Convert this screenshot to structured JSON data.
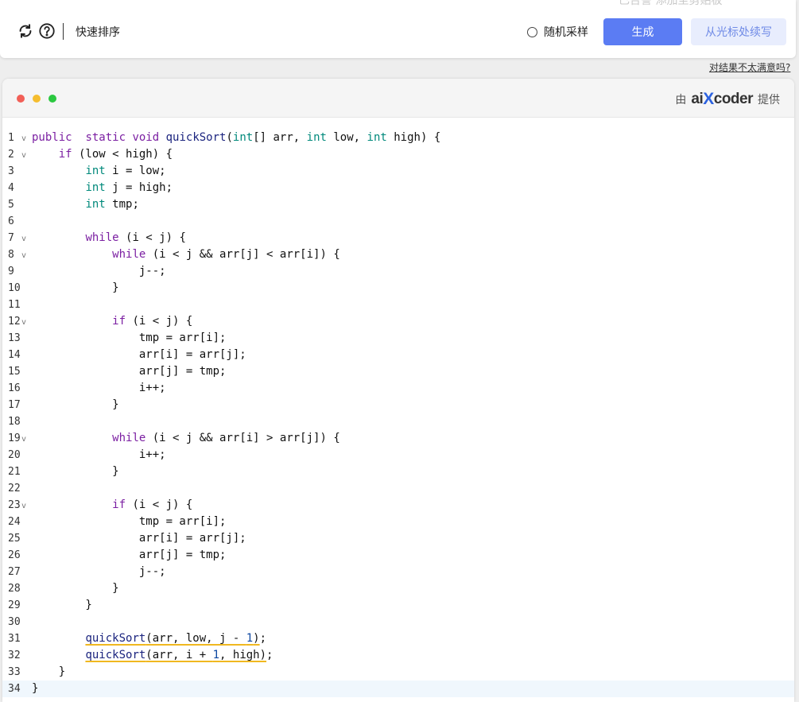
{
  "topbar": {
    "ghost_text": "已告警  添加至剪贴板",
    "mode_label": "快速排序",
    "random_sampling_label": "随机采样",
    "generate_label": "生成",
    "continue_label": "从光标处续写"
  },
  "feedback_link": "对结果不太满意吗?",
  "editor": {
    "provider_prefix": "由",
    "brand_left": "ai",
    "brand_x": "X",
    "brand_right": "coder",
    "provider_suffix": "提供",
    "active_line": 34,
    "lines": [
      {
        "n": "1",
        "fold": true,
        "tokens": [
          [
            "kw",
            "public"
          ],
          [
            "",
            "  "
          ],
          [
            "kw",
            "static"
          ],
          [
            "",
            " "
          ],
          [
            "kw",
            "void"
          ],
          [
            "",
            " "
          ],
          [
            "fn",
            "quickSort"
          ],
          [
            "",
            "("
          ],
          [
            "ty",
            "int"
          ],
          [
            "",
            "[] arr, "
          ],
          [
            "ty",
            "int"
          ],
          [
            "",
            " low, "
          ],
          [
            "ty",
            "int"
          ],
          [
            "",
            " high) {"
          ]
        ]
      },
      {
        "n": "2",
        "fold": true,
        "tokens": [
          [
            "",
            "    "
          ],
          [
            "kw",
            "if"
          ],
          [
            "",
            " (low < high) {"
          ]
        ]
      },
      {
        "n": "3",
        "fold": false,
        "tokens": [
          [
            "",
            "        "
          ],
          [
            "ty",
            "int"
          ],
          [
            "",
            " i = low;"
          ]
        ]
      },
      {
        "n": "4",
        "fold": false,
        "tokens": [
          [
            "",
            "        "
          ],
          [
            "ty",
            "int"
          ],
          [
            "",
            " j = high;"
          ]
        ]
      },
      {
        "n": "5",
        "fold": false,
        "tokens": [
          [
            "",
            "        "
          ],
          [
            "ty",
            "int"
          ],
          [
            "",
            " tmp;"
          ]
        ]
      },
      {
        "n": "6",
        "fold": false,
        "tokens": []
      },
      {
        "n": "7",
        "fold": true,
        "tokens": [
          [
            "",
            "        "
          ],
          [
            "kw",
            "while"
          ],
          [
            "",
            " (i < j) {"
          ]
        ]
      },
      {
        "n": "8",
        "fold": true,
        "tokens": [
          [
            "",
            "            "
          ],
          [
            "kw",
            "while"
          ],
          [
            "",
            " (i < j && arr[j] < arr[i]) {"
          ]
        ]
      },
      {
        "n": "9",
        "fold": false,
        "tokens": [
          [
            "",
            "                j--;"
          ]
        ]
      },
      {
        "n": "10",
        "fold": false,
        "tokens": [
          [
            "",
            "            }"
          ]
        ]
      },
      {
        "n": "11",
        "fold": false,
        "tokens": []
      },
      {
        "n": "12",
        "fold": true,
        "tokens": [
          [
            "",
            "            "
          ],
          [
            "kw",
            "if"
          ],
          [
            "",
            " (i < j) {"
          ]
        ]
      },
      {
        "n": "13",
        "fold": false,
        "tokens": [
          [
            "",
            "                tmp = arr[i];"
          ]
        ]
      },
      {
        "n": "14",
        "fold": false,
        "tokens": [
          [
            "",
            "                arr[i] = arr[j];"
          ]
        ]
      },
      {
        "n": "15",
        "fold": false,
        "tokens": [
          [
            "",
            "                arr[j] = tmp;"
          ]
        ]
      },
      {
        "n": "16",
        "fold": false,
        "tokens": [
          [
            "",
            "                i++;"
          ]
        ]
      },
      {
        "n": "17",
        "fold": false,
        "tokens": [
          [
            "",
            "            }"
          ]
        ]
      },
      {
        "n": "18",
        "fold": false,
        "tokens": []
      },
      {
        "n": "19",
        "fold": true,
        "tokens": [
          [
            "",
            "            "
          ],
          [
            "kw",
            "while"
          ],
          [
            "",
            " (i < j && arr[i] > arr[j]) {"
          ]
        ]
      },
      {
        "n": "20",
        "fold": false,
        "tokens": [
          [
            "",
            "                i++;"
          ]
        ]
      },
      {
        "n": "21",
        "fold": false,
        "tokens": [
          [
            "",
            "            }"
          ]
        ]
      },
      {
        "n": "22",
        "fold": false,
        "tokens": []
      },
      {
        "n": "23",
        "fold": true,
        "tokens": [
          [
            "",
            "            "
          ],
          [
            "kw",
            "if"
          ],
          [
            "",
            " (i < j) {"
          ]
        ]
      },
      {
        "n": "24",
        "fold": false,
        "tokens": [
          [
            "",
            "                tmp = arr[i];"
          ]
        ]
      },
      {
        "n": "25",
        "fold": false,
        "tokens": [
          [
            "",
            "                arr[i] = arr[j];"
          ]
        ]
      },
      {
        "n": "26",
        "fold": false,
        "tokens": [
          [
            "",
            "                arr[j] = tmp;"
          ]
        ]
      },
      {
        "n": "27",
        "fold": false,
        "tokens": [
          [
            "",
            "                j--;"
          ]
        ]
      },
      {
        "n": "28",
        "fold": false,
        "tokens": [
          [
            "",
            "            }"
          ]
        ]
      },
      {
        "n": "29",
        "fold": false,
        "tokens": [
          [
            "",
            "        }"
          ]
        ]
      },
      {
        "n": "30",
        "fold": false,
        "tokens": []
      },
      {
        "n": "31",
        "fold": false,
        "tokens": [
          [
            "",
            "        "
          ],
          [
            "fn squiggle",
            "quickSort"
          ],
          [
            "squiggle",
            "(arr, low, j - "
          ],
          [
            "num squiggle",
            "1"
          ],
          [
            "squiggle",
            ")"
          ],
          [
            "",
            ";"
          ]
        ]
      },
      {
        "n": "32",
        "fold": false,
        "tokens": [
          [
            "",
            "        "
          ],
          [
            "fn squiggle",
            "quickSort"
          ],
          [
            "squiggle",
            "(arr, i + "
          ],
          [
            "num squiggle",
            "1"
          ],
          [
            "squiggle",
            ", high)"
          ],
          [
            "",
            ";"
          ]
        ]
      },
      {
        "n": "33",
        "fold": false,
        "tokens": [
          [
            "",
            "    }"
          ]
        ]
      },
      {
        "n": "34",
        "fold": false,
        "tokens": [
          [
            "",
            "}"
          ]
        ]
      }
    ]
  },
  "colors": {
    "primary": "#5b7cf3",
    "secondary_bg": "#e8edfd",
    "dot_red": "#f25f57",
    "dot_yellow": "#f5bd2f",
    "dot_green": "#2bc840"
  },
  "icons": {
    "refresh": "refresh-icon",
    "help": "help-icon"
  }
}
